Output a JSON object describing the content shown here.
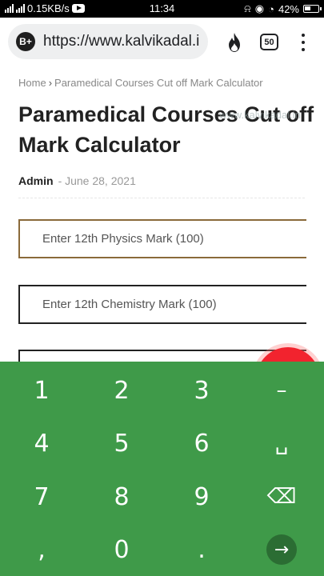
{
  "statusbar": {
    "network_speed": "0.15KB/s",
    "time": "11:34",
    "battery": "42%"
  },
  "browser": {
    "url": "https://www.kalvikadal.i",
    "tab_count": "50",
    "brave_badge": "B+"
  },
  "page": {
    "breadcrumb": {
      "home": "Home",
      "separator": "›",
      "current": "Paramedical Courses Cut off Mark Calculator"
    },
    "title": "Paramedical Courses Cut off Mark Calculator",
    "watermark": "www.kalvikadal.in",
    "author": "Admin",
    "date": "- June 28, 2021",
    "fields": {
      "physics_placeholder": "Enter 12th Physics Mark (100)",
      "chemistry_placeholder": "Enter 12th Chemistry Mark (100)",
      "third_placeholder": ""
    }
  },
  "keyboard": {
    "keys": [
      "1",
      "2",
      "3",
      "–",
      "4",
      "5",
      "6",
      "␣",
      "7",
      "8",
      "9",
      "⌫",
      ",",
      "0",
      ".",
      "→"
    ],
    "accent": "#3f9a49"
  }
}
